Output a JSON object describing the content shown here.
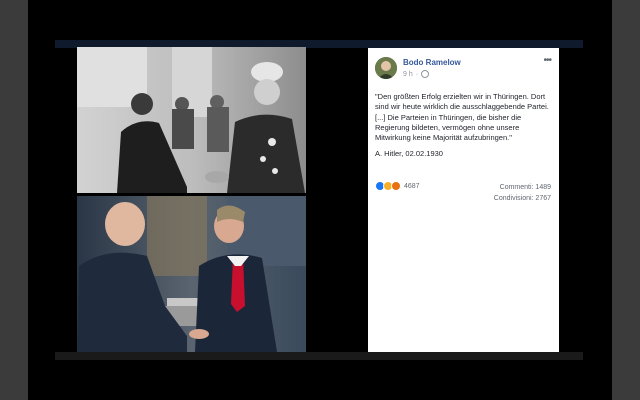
{
  "post": {
    "author": "Bodo Ramelow",
    "time": "9 h",
    "quote": "\"Den größten Erfolg erzielten wir in Thüringen. Dort sind wir heute wirklich die ausschlaggebende Partei.[...] Die Parteien in Thüringen, die bisher die Regierung bildeten, vermögen ohne unsere Mitwirkung keine Majorität aufzubringen.\"",
    "attribution": "A. Hitler, 02.02.1930",
    "reaction_count": "4687",
    "comments": "Commenti: 1489",
    "shares": "Condivisioni: 2767"
  },
  "icons": {
    "more": "more-options-icon",
    "privacy": "globe-icon",
    "reactions": [
      "like-icon",
      "sad-icon",
      "angry-icon"
    ]
  },
  "colors": {
    "author_link": "#365899",
    "like": "#1877f2",
    "sad": "#f7b125",
    "angry": "#e9710f"
  }
}
